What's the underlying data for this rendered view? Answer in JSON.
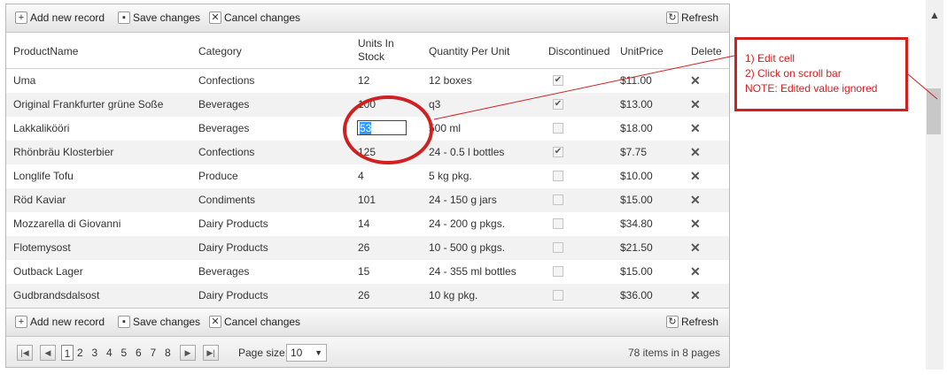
{
  "toolbar": {
    "add_label": "Add new record",
    "save_label": "Save changes",
    "cancel_label": "Cancel changes",
    "refresh_label": "Refresh"
  },
  "columns": {
    "product_name": "ProductName",
    "category": "Category",
    "units_line1": "Units In",
    "units_line2": "Stock",
    "qty": "Quantity Per Unit",
    "discontinued": "Discontinued",
    "price": "UnitPrice",
    "delete": "Delete"
  },
  "rows": [
    {
      "name": "Uma",
      "category": "Confections",
      "units": "12",
      "qty": "12 boxes",
      "discontinued": true,
      "price": "$11.00"
    },
    {
      "name": "Original Frankfurter grüne Soße",
      "category": "Beverages",
      "units": "100",
      "qty": "q3",
      "discontinued": true,
      "price": "$13.00"
    },
    {
      "name": "Lakkalikööri",
      "category": "Beverages",
      "units": "53",
      "qty": "500 ml",
      "discontinued": false,
      "price": "$18.00"
    },
    {
      "name": "Rhönbräu Klosterbier",
      "category": "Confections",
      "units": "125",
      "qty": "24 - 0.5 l bottles",
      "discontinued": true,
      "price": "$7.75"
    },
    {
      "name": "Longlife Tofu",
      "category": "Produce",
      "units": "4",
      "qty": "5 kg pkg.",
      "discontinued": false,
      "price": "$10.00"
    },
    {
      "name": "Röd Kaviar",
      "category": "Condiments",
      "units": "101",
      "qty": "24 - 150 g jars",
      "discontinued": false,
      "price": "$15.00"
    },
    {
      "name": "Mozzarella di Giovanni",
      "category": "Dairy Products",
      "units": "14",
      "qty": "24 - 200 g pkgs.",
      "discontinued": false,
      "price": "$34.80"
    },
    {
      "name": "Flotemysost",
      "category": "Dairy Products",
      "units": "26",
      "qty": "10 - 500 g pkgs.",
      "discontinued": false,
      "price": "$21.50"
    },
    {
      "name": "Outback Lager",
      "category": "Beverages",
      "units": "15",
      "qty": "24 - 355 ml bottles",
      "discontinued": false,
      "price": "$15.00"
    },
    {
      "name": "Gudbrandsdalsost",
      "category": "Dairy Products",
      "units": "26",
      "qty": "10 kg pkg.",
      "discontinued": false,
      "price": "$36.00"
    }
  ],
  "edit_value": "53",
  "pager": {
    "pages": [
      "1",
      "2",
      "3",
      "4",
      "5",
      "6",
      "7",
      "8"
    ],
    "current_page": "1",
    "page_size_label": "Page size:",
    "page_size": "10",
    "info": "78 items in 8 pages"
  },
  "annotation": {
    "line1": "1) Edit cell",
    "line2": "2) Click on scroll bar",
    "line3": "NOTE: Edited value ignored",
    "color": "#d02020"
  },
  "icons": {
    "add": "plus-icon",
    "save": "save-icon",
    "cancel": "close-icon",
    "refresh": "refresh-icon",
    "delete": "delete-x-icon"
  }
}
